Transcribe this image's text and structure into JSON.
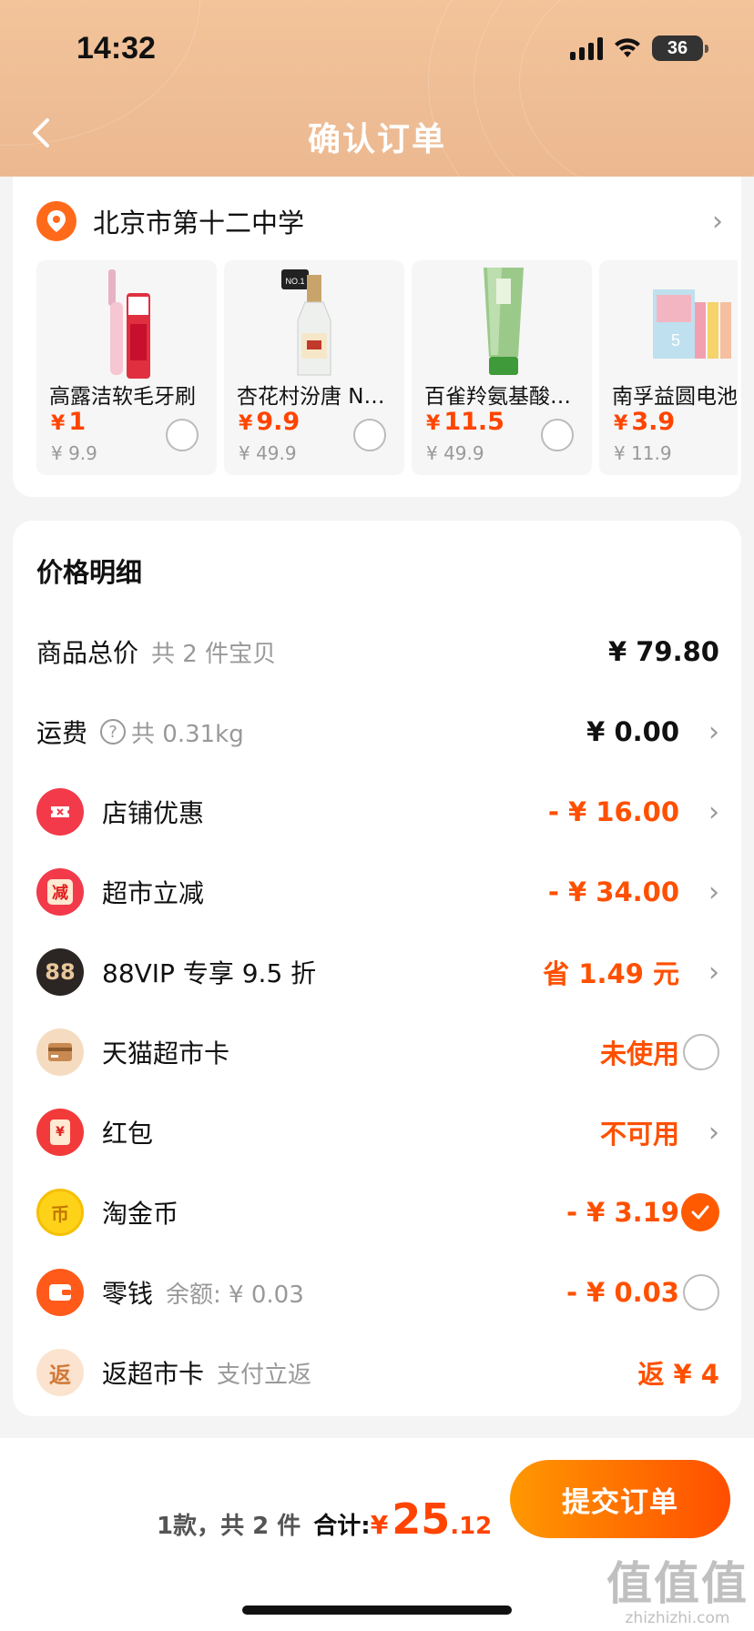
{
  "status_bar": {
    "time": "14:32",
    "battery": "36"
  },
  "header": {
    "title": "确认订单"
  },
  "address": {
    "text": "北京市第十二中学"
  },
  "products": [
    {
      "name": "高露洁软毛牙刷",
      "price": "1",
      "original": "¥ 9.9",
      "icon": "toothbrush-image"
    },
    {
      "name": "杏花村汾唐 N…",
      "price": "9.9",
      "original": "¥ 49.9",
      "icon": "liquor-bottle-image",
      "badge": "NO.1"
    },
    {
      "name": "百雀羚氨基酸洁面",
      "price": "11.5",
      "original": "¥ 49.9",
      "icon": "cleanser-tube-image"
    },
    {
      "name": "南孚益圆电池",
      "price": "3.9",
      "original": "¥ 11.9",
      "icon": "battery-pack-image"
    }
  ],
  "price_detail": {
    "title": "价格明细",
    "goods_total": {
      "label": "商品总价",
      "sub": "共 2 件宝贝",
      "value": "¥ 79.80"
    },
    "shipping": {
      "label": "运费",
      "sub": "共 0.31kg",
      "value": "¥ 0.00"
    },
    "store_discount": {
      "label": "店铺优惠",
      "value": "- ¥ 16.00",
      "icon": "ticket-icon"
    },
    "market_discount": {
      "label": "超市立减",
      "value": "- ¥ 34.00",
      "icon": "discount-icon",
      "icon_text": "减"
    },
    "vip": {
      "label": "88VIP 专享 9.5 折",
      "value": "省 1.49 元",
      "icon": "88vip-icon",
      "icon_text": "88"
    },
    "market_card": {
      "label": "天猫超市卡",
      "value": "未使用",
      "icon": "card-icon"
    },
    "red_packet": {
      "label": "红包",
      "value": "不可用",
      "icon": "red-packet-icon",
      "icon_text": "¥"
    },
    "coins": {
      "label": "淘金币",
      "value": "- ¥ 3.19",
      "icon": "coin-icon",
      "icon_text": "币"
    },
    "change": {
      "label": "零钱",
      "sub": "余额: ¥ 0.03",
      "value": "- ¥ 0.03",
      "icon": "wallet-icon"
    },
    "rebate": {
      "label": "返超市卡",
      "sub": "支付立返",
      "value": "返 ¥ 4",
      "icon": "rebate-icon",
      "icon_text": "返"
    }
  },
  "bottom_bar": {
    "count": "1款，共 2 件",
    "total_label": "合计:",
    "total_yen": "¥",
    "total_int": "25",
    "total_dec": ".12",
    "submit": "提交订单"
  },
  "watermark": {
    "big": "值值值",
    "small": "zhizhizhi.com"
  },
  "colors": {
    "accent": "#ff5000",
    "header_bg": "#f0be96"
  }
}
